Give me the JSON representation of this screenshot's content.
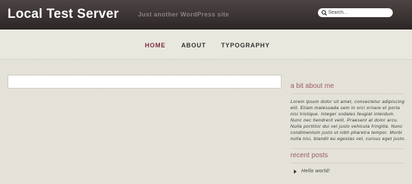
{
  "header": {
    "site_title": "Local Test Server",
    "tagline": "Just another WordPress site",
    "search_placeholder": "Search..."
  },
  "nav": {
    "items": [
      {
        "label": "HOME",
        "active": true
      },
      {
        "label": "ABOUT",
        "active": false
      },
      {
        "label": "TYPOGRAPHY",
        "active": false
      }
    ]
  },
  "sidebar": {
    "about_title": "a bit about me",
    "about_text": "Lorem ipsum dolor sit amet, consectetur adipiscing elit. Etiam malesuada sem in orci ornare et porta nisi tristique. Integer sodales feugiat interdum. Nunc nec hendrerit velit. Praesent at dolor arcu. Nulla porttitor dui vel justo vehicula fringilla. Nunc condimentum justo ut nibh pharetra tempor. Morbi nulla nisi, blandit eu egestas vel, cursus eget justo.",
    "recent_title": "recent posts",
    "recent_posts": [
      "Hello world!"
    ]
  },
  "colors": {
    "header_bg": "#3a3333",
    "active_nav": "#7a2b43",
    "sidebar_heading": "#9a5a6a",
    "page_bg": "#e6e4da"
  },
  "icons": {
    "search": "search-icon",
    "bullet": "bullet-arrow-icon"
  }
}
